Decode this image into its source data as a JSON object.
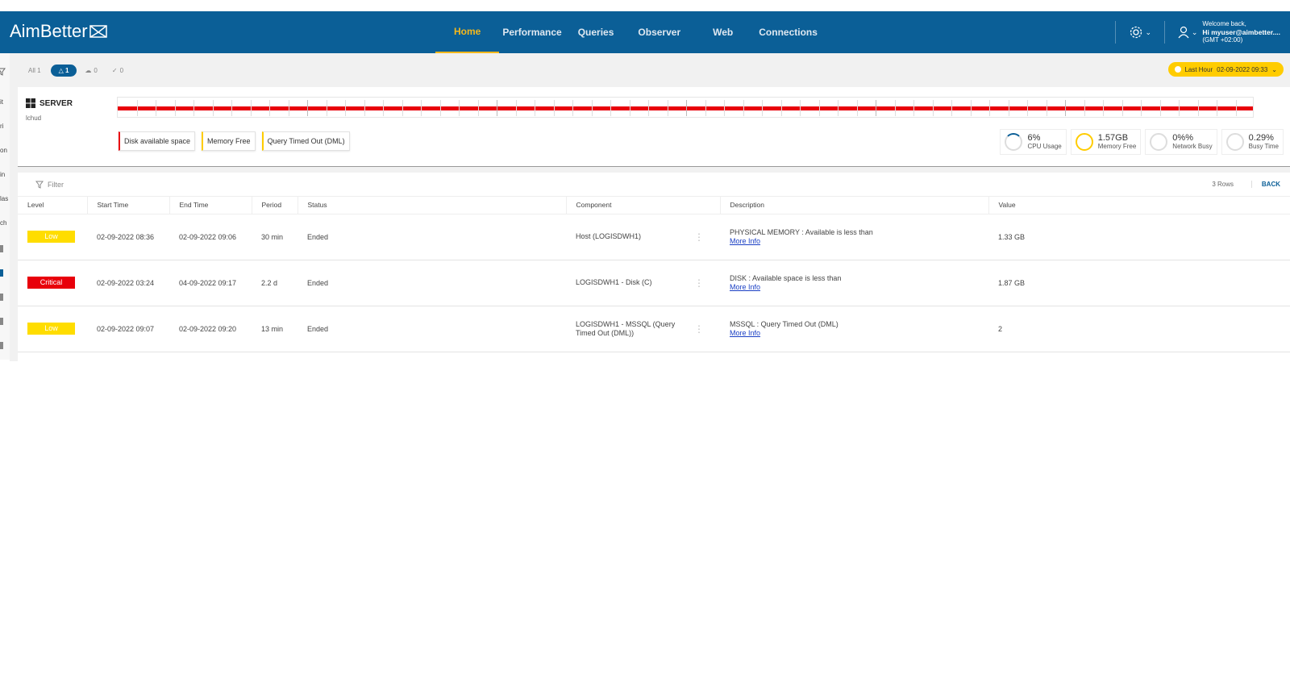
{
  "header": {
    "logo": "AimBetter",
    "nav": [
      "Home",
      "Performance",
      "Queries",
      "Observer",
      "Web",
      "Connections"
    ],
    "user": {
      "welcome": "Welcome back,",
      "greeting": "Hi myuser@aimbetter....",
      "timezone": "(GMT +02:00)"
    }
  },
  "sidebar_fragments": [
    "it",
    "ri",
    "on",
    "in",
    "las",
    "ch"
  ],
  "filters": {
    "all": "All 1",
    "alerts": "1",
    "cloud": "0",
    "check": "0",
    "time_range": "Last Hour",
    "time_value": "02-09-2022 09:33"
  },
  "server": {
    "title": "SERVER",
    "subtitle": "lchud",
    "tags": [
      {
        "label": "Disk available space",
        "color": "#e8000b"
      },
      {
        "label": "Memory Free",
        "color": "#ffcc00"
      },
      {
        "label": "Query Timed Out (DML)",
        "color": "#ffcc00"
      }
    ],
    "metrics": [
      {
        "value": "6%",
        "label": "CPU Usage",
        "ring": "#dddddd",
        "accent": "#0b5f97"
      },
      {
        "value": "1.57GB",
        "label": "Memory Free",
        "ring": "#ffcc00"
      },
      {
        "value": "0%%",
        "label": "Network Busy",
        "ring": "#dddddd"
      },
      {
        "value": "0.29%",
        "label": "Busy Time",
        "ring": "#dddddd"
      }
    ]
  },
  "table": {
    "filter_label": "Filter",
    "rows_label": "3 Rows",
    "back_label": "BACK",
    "columns": [
      "Level",
      "Start Time",
      "End Time",
      "Period",
      "Status",
      "Component",
      "Description",
      "Value"
    ],
    "rows": [
      {
        "level": "Low",
        "start": "02-09-2022 08:36",
        "end": "02-09-2022 09:06",
        "period": "30 min",
        "status": "Ended",
        "component": "Host (LOGISDWH1)",
        "description": "PHYSICAL MEMORY : Available is less than",
        "more": "More Info",
        "value": "1.33 GB"
      },
      {
        "level": "Critical",
        "start": "02-09-2022 03:24",
        "end": "04-09-2022 09:17",
        "period": "2.2 d",
        "status": "Ended",
        "component": "LOGISDWH1 - Disk (C)",
        "description": "DISK : Available space is less than",
        "more": "More Info",
        "value": "1.87 GB"
      },
      {
        "level": "Low",
        "start": "02-09-2022 09:07",
        "end": "02-09-2022 09:20",
        "period": "13 min",
        "status": "Ended",
        "component": "LOGISDWH1 - MSSQL (Query Timed Out (DML))",
        "description": "MSSQL : Query Timed Out (DML)",
        "more": "More Info",
        "value": "2"
      }
    ]
  }
}
